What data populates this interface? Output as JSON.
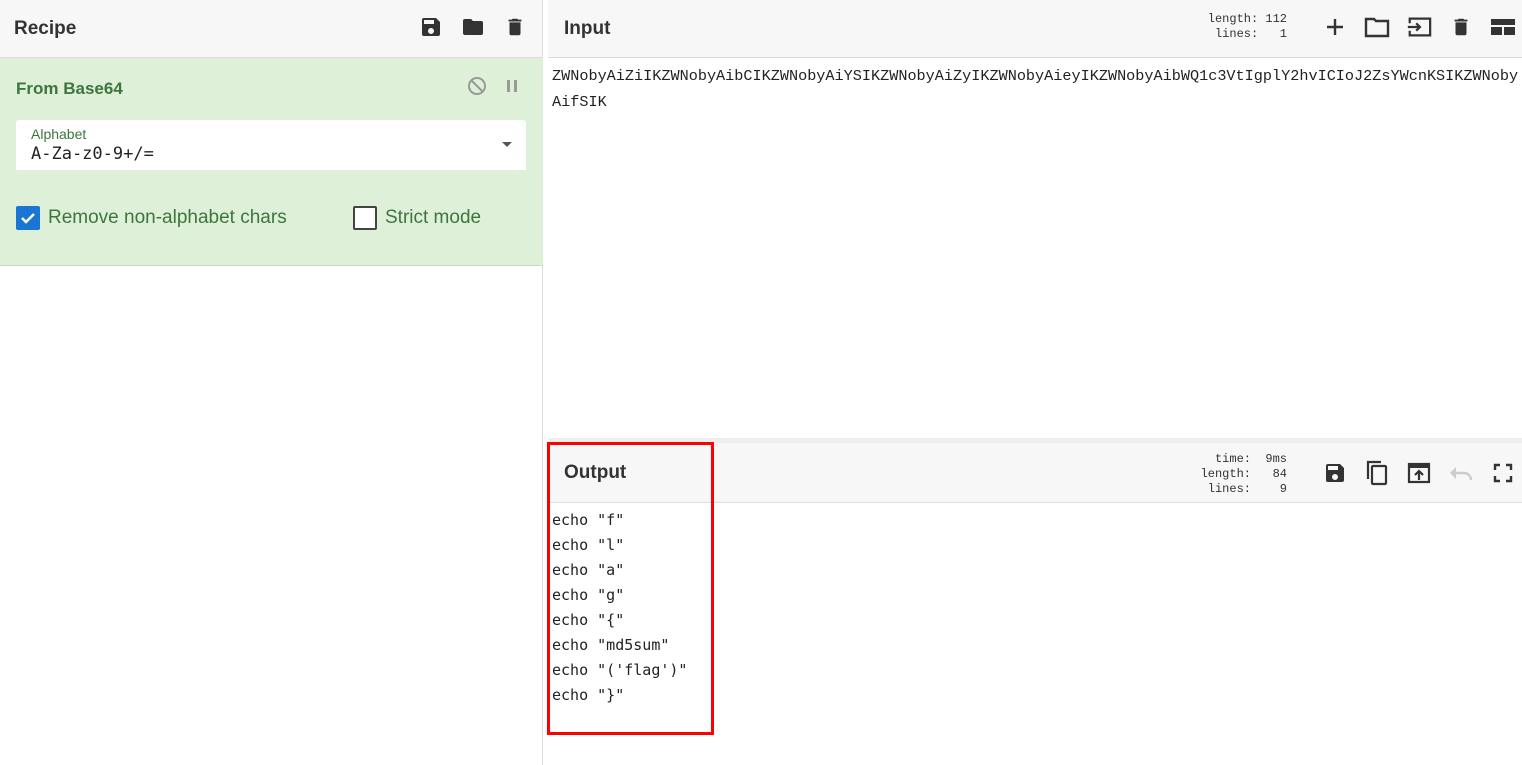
{
  "recipe": {
    "title": "Recipe",
    "icons": [
      "save-icon",
      "folder-icon",
      "trash-icon"
    ]
  },
  "operation": {
    "name": "From Base64",
    "alphabet_label": "Alphabet",
    "alphabet_value": "A-Za-z0-9+/=",
    "remove_non_alphabet_label": "Remove non-alphabet chars",
    "remove_non_alphabet_checked": true,
    "strict_mode_label": "Strict mode",
    "strict_mode_checked": false
  },
  "input": {
    "title": "Input",
    "length_line": "length: 112",
    "lines_line": " lines:   1",
    "text": "ZWNobyAiZiIKZWNobyAibCIKZWNobyAiYSIKZWNobyAiZyIKZWNobyAieyIKZWNobyAibWQ1c3VtIgplY2hvICIoJ2ZsYWcnKSIKZWNobyAifSIK"
  },
  "output": {
    "title": "Output",
    "time_line": "  time:  9ms",
    "length_line": "length:   84",
    "lines_line": " lines:    9",
    "lines": [
      "echo \"f\"",
      "echo \"l\"",
      "echo \"a\"",
      "echo \"g\"",
      "echo \"{\"",
      "echo \"md5sum\"",
      "echo \"('flag')\"",
      "echo \"}\""
    ]
  },
  "colors": {
    "operation_bg": "#dff0d8",
    "operation_text": "#3c763d",
    "highlight": "#ff0000",
    "checkbox": "#1976d2"
  }
}
